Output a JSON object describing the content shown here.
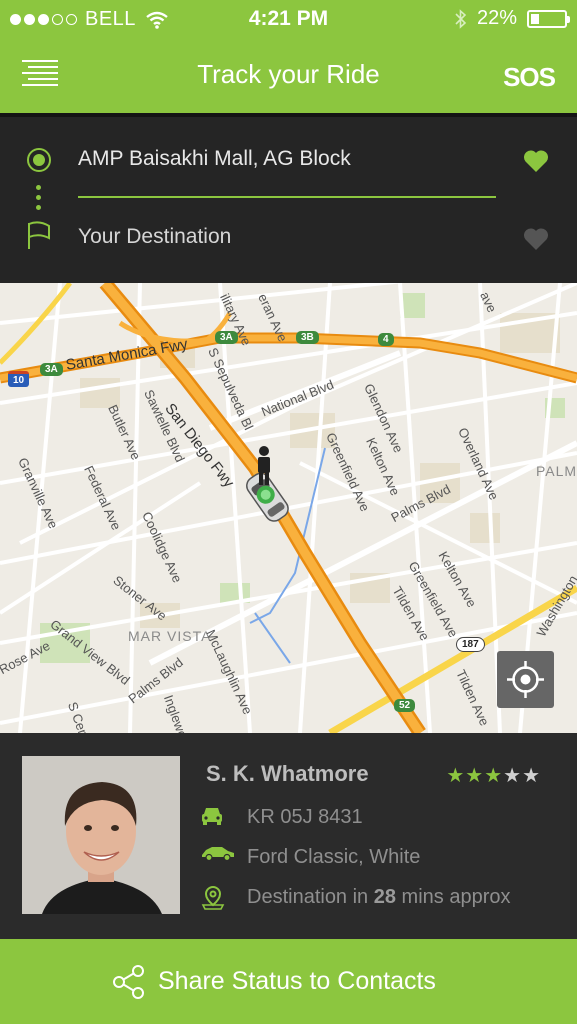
{
  "status_bar": {
    "carrier": "BELL",
    "time": "4:21 PM",
    "battery": "22%",
    "signal_bars": 3,
    "signal_total": 5
  },
  "header": {
    "title": "Track your Ride",
    "sos_label": "SOS",
    "menu_icon": "menu-icon"
  },
  "route": {
    "origin": "AMP Baisakhi Mall, AG Block",
    "destination": "Your Destination",
    "origin_favorited": true,
    "destination_favorited": false
  },
  "map": {
    "labels": {
      "santa_monica_fwy": "Santa Monica Fwy",
      "san_diego_fwy": "San Diego Fwy",
      "national_blvd": "National Blvd",
      "sawtelle_blvd": "Sawtelle Blvd",
      "s_sepulveda": "S Sepulveda Bl",
      "butler_ave": "Butler Ave",
      "granville_ave": "Granville Ave",
      "federal_ave": "Federal Ave",
      "coolidge_ave": "Coolidge Ave",
      "stoner_ave": "Stoner Ave",
      "grand_view_blvd": "Grand View Blvd",
      "mar_vista": "MAR VISTA",
      "mclaughlin_ave": "McLaughlin Ave",
      "palms_blvd": "Palms Blvd",
      "palms_blvd_2": "Palms Blvd",
      "inglewood": "Inglewood",
      "s_centinela": "S Centi",
      "rose_ave": "Rose Ave",
      "glendon_ave": "Glendon Ave",
      "kelton_ave": "Kelton Ave",
      "kelton_ave_2": "Kelton Ave",
      "greenfield_ave": "Greenfield Ave",
      "greenfield_ave_2": "Greenfield Ave",
      "overland_ave": "Overland Ave",
      "tilden_ave": "Tilden Ave",
      "tilden_ave_2": "Tilden Ave",
      "military_ave": "ilitary Ave",
      "veteran_ave": "eran Ave",
      "palms": "PALMS",
      "washington": "Washington",
      "ave_top": "ave"
    },
    "shields": {
      "i10": "10",
      "r3a_left": "3A",
      "r3a_right": "3A",
      "r3b": "3B",
      "r4": "4",
      "r187": "187",
      "r52": "52"
    },
    "locate_button_icon": "crosshair-icon"
  },
  "driver": {
    "name": "S. K. Whatmore",
    "rating": 3,
    "rating_max": 5,
    "plate": "KR 05J 8431",
    "vehicle": "Ford Classic, White",
    "eta_prefix": "Destination in ",
    "eta_value": "28",
    "eta_suffix": " mins approx"
  },
  "share": {
    "label": "Share Status to Contacts"
  },
  "colors": {
    "accent": "#8cc63f",
    "panel_dark": "#252525",
    "freeway": "#f5a623"
  }
}
